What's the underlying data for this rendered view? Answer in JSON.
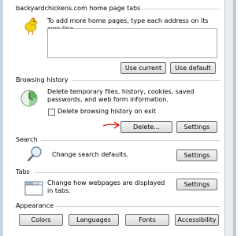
{
  "home_page": {
    "title": "backyardchickens.com home page tabs",
    "description": "To add more home pages, type each address on its own line.",
    "use_current": "Use current",
    "use_default": "Use default"
  },
  "browsing_history": {
    "title": "Browsing history",
    "description": "Delete temporary files, history, cookies, saved passwords, and web form information.",
    "checkbox_label": "Delete browsing history on exit",
    "delete_button": "Delete...",
    "settings_button": "Settings"
  },
  "search": {
    "title": "Search",
    "description": "Change search defaults.",
    "settings_button": "Settings"
  },
  "tabs": {
    "title": "Tabs",
    "description": "Change how webpages are displayed in tabs.",
    "settings_button": "Settings"
  },
  "appearance": {
    "title": "Appearance",
    "colors": "Colors",
    "languages": "Languages",
    "fonts": "Fonts",
    "accessibility": "Accessibility"
  },
  "icons": {
    "chicken": "chicken-icon",
    "history": "history-icon",
    "search": "magnifier-icon",
    "tabs": "tabs-icon",
    "arrow": "red-arrow-annotation"
  }
}
